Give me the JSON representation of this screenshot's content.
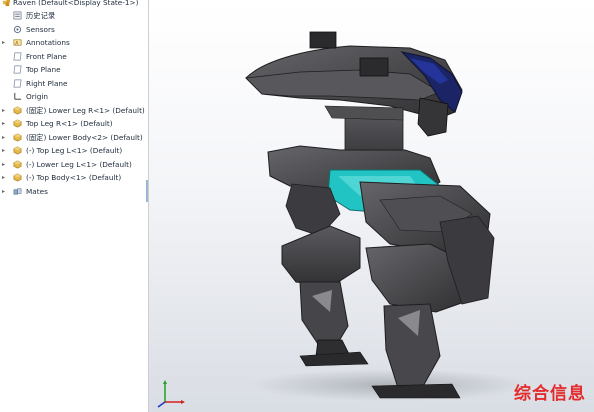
{
  "tree": {
    "root_label": "Raven  (Default<Display State-1>)",
    "items": [
      {
        "label": "历史记录",
        "expander": "",
        "icon": "history-icon"
      },
      {
        "label": "Sensors",
        "expander": "",
        "icon": "sensor-icon"
      },
      {
        "label": "Annotations",
        "expander": "▸",
        "icon": "annotation-icon"
      },
      {
        "label": "Front Plane",
        "expander": "",
        "icon": "plane-icon"
      },
      {
        "label": "Top Plane",
        "expander": "",
        "icon": "plane-icon"
      },
      {
        "label": "Right Plane",
        "expander": "",
        "icon": "plane-icon"
      },
      {
        "label": "Origin",
        "expander": "",
        "icon": "origin-icon"
      },
      {
        "label": "(固定) Lower Leg R<1> (Default)",
        "expander": "▸",
        "icon": "part-icon"
      },
      {
        "label": "Top Leg R<1> (Default)",
        "expander": "▸",
        "icon": "part-icon"
      },
      {
        "label": "(固定) Lower Body<2> (Default)",
        "expander": "▸",
        "icon": "part-icon"
      },
      {
        "label": "(-) Top Leg L<1> (Default)",
        "expander": "▸",
        "icon": "part-icon"
      },
      {
        "label": "(-) Lower Leg L<1> (Default)",
        "expander": "▸",
        "icon": "part-icon"
      },
      {
        "label": "(-) Top Body<1> (Default)",
        "expander": "▸",
        "icon": "part-icon"
      },
      {
        "label": "Mates",
        "expander": "▸",
        "icon": "mates-icon"
      }
    ]
  },
  "watermark": "综合信息",
  "colors": {
    "accent": "#22c3c3",
    "body": "#4a4a4d",
    "visor": "#1a2a8a",
    "watermark": "#e42b2b"
  }
}
